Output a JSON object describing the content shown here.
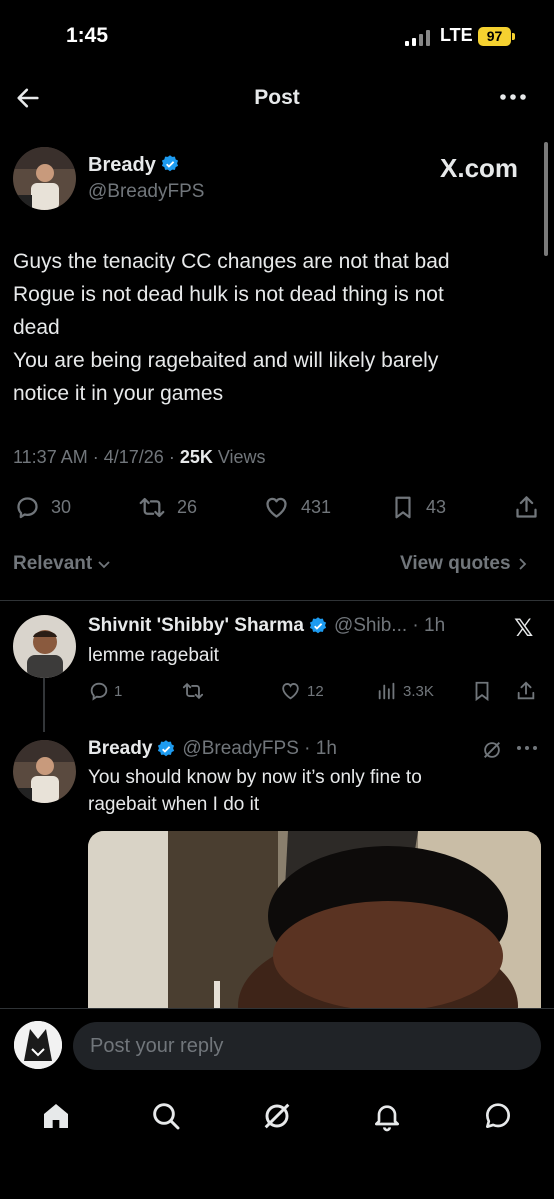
{
  "status_bar": {
    "time": "1:45",
    "network": "LTE",
    "battery": "97"
  },
  "header": {
    "title": "Post",
    "back_icon": "arrow-left-icon",
    "more_icon": "more-dots-icon"
  },
  "post": {
    "author_name": "Bready",
    "author_handle": "@BreadyFPS",
    "badge": "X.com",
    "text_lines": [
      "Guys the tenacity CC changes are not that bad",
      "Rogue is not dead hulk is not dead thing is not",
      "dead",
      "You are being ragebaited and will likely barely",
      "notice it in your games"
    ],
    "time": "11:37 AM",
    "date": "4/17/26",
    "views_count": "25K",
    "views_label": "Views",
    "stats": {
      "replies": "30",
      "reposts": "26",
      "likes": "431",
      "bookmarks": "43"
    }
  },
  "filters": {
    "sort": "Relevant",
    "view_quotes": "View quotes"
  },
  "replies": [
    {
      "author_name": "Shivnit 'Shibby' Sharma",
      "handle_time": "@Shib... · 1h",
      "text": "lemme ragebait",
      "stats": {
        "replies": "1",
        "likes": "12",
        "views": "3.3K"
      }
    },
    {
      "author_name": "Bready",
      "handle_time": "@BreadyFPS · 1h",
      "text_lines": [
        "You should know by now it’s only fine to",
        "ragebait when I do it"
      ]
    }
  ],
  "compose": {
    "placeholder": "Post your reply"
  },
  "nav": [
    "home-icon",
    "search-icon",
    "grok-icon",
    "notifications-icon",
    "messages-icon"
  ],
  "colors": {
    "verified": "#1d9bf0",
    "battery": "#f5d130",
    "muted": "#71767b"
  }
}
